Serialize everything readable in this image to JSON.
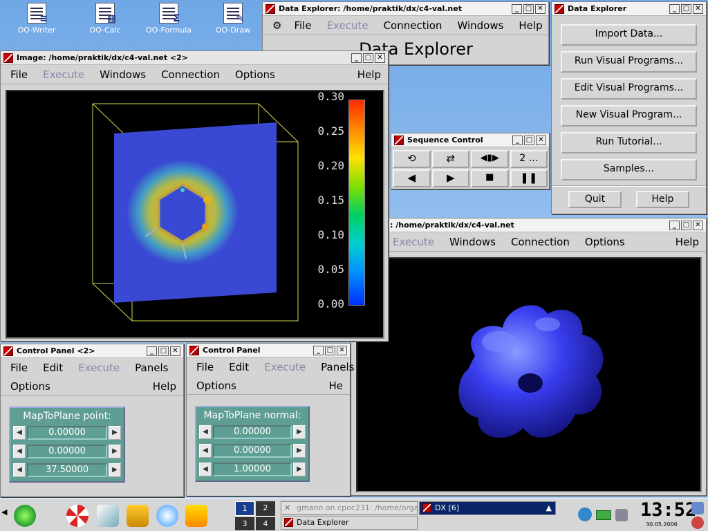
{
  "desktop_icons": [
    {
      "label": "OO-Writer",
      "glyph": "≡"
    },
    {
      "label": "OO-Calc",
      "glyph": "▦"
    },
    {
      "label": "OO-Formula",
      "glyph": "Σ"
    },
    {
      "label": "OO-Draw",
      "glyph": "✎"
    }
  ],
  "dx_main": {
    "title": "Data Explorer: /home/praktik/dx/c4-val.net",
    "menu": [
      "File",
      "Execute",
      "Connection",
      "Windows",
      "Help"
    ],
    "heading": "Data Explorer"
  },
  "dx_launcher": {
    "title": "Data Explorer",
    "buttons": [
      "Import Data...",
      "Run Visual Programs...",
      "Edit Visual Programs...",
      "New Visual Program...",
      "Run Tutorial...",
      "Samples..."
    ],
    "quit": "Quit",
    "help": "Help"
  },
  "image2": {
    "title": "Image: /home/praktik/dx/c4-val.net <2>",
    "menu": [
      "File",
      "Execute",
      "Windows",
      "Connection",
      "Options",
      "Help"
    ],
    "colorbar_ticks": [
      "0.30",
      "0.25",
      "0.20",
      "0.15",
      "0.10",
      "0.05",
      "0.00"
    ]
  },
  "image1": {
    "title": ": /home/praktik/dx/c4-val.net",
    "menu": [
      "Execute",
      "Windows",
      "Connection",
      "Options",
      "Help"
    ]
  },
  "sequence": {
    "title": "Sequence Control",
    "frame": "2",
    "more": "..."
  },
  "cp2": {
    "title": "Control Panel <2>",
    "menu1": [
      "File",
      "Edit",
      "Execute",
      "Panels"
    ],
    "menu2": [
      "Options",
      "Help"
    ],
    "label": "MapToPlane point:",
    "values": [
      "0.00000",
      "0.00000",
      "37.50000"
    ]
  },
  "cp1": {
    "title": "Control Panel",
    "menu1": [
      "File",
      "Edit",
      "Execute",
      "Panels"
    ],
    "menu2": [
      "Options",
      "He"
    ],
    "label": "MapToPlane normal:",
    "values": [
      "0.00000",
      "0.00000",
      "1.00000"
    ]
  },
  "taskbar": {
    "pager": [
      "1",
      "2",
      "3",
      "4"
    ],
    "task1": "gmann on cpoc231: /home/orga",
    "task2": "Data Explorer",
    "task3": "DX [6]",
    "clock": "13:52",
    "date": "30.05.2006"
  }
}
